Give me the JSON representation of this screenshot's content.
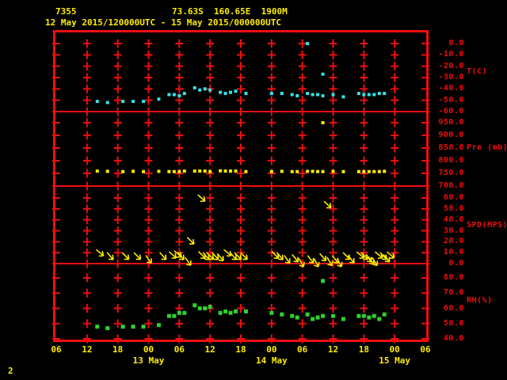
{
  "header": {
    "station_id": "7355",
    "location": "73.63S  160.65E  1900M",
    "period": "12 May 2015/120000UTC - 15 May 2015/000000UTC"
  },
  "footer": {
    "page_number": "2"
  },
  "colors": {
    "background": "#000000",
    "grid_red": "#ee0e0e",
    "text_yellow": "#ffec00",
    "temperature_cyan": "#35e2e2",
    "pressure_yellow": "#ffec00",
    "wind_yellow": "#ffec00",
    "humidity_green": "#2fd12f"
  },
  "chart_data": {
    "type": "scatter",
    "subtype": "multi-panel meteogram",
    "title": "12 May 2015/120000UTC - 15 May 2015/000000UTC",
    "x_axis": {
      "hours_span": 72,
      "tick_interval_hours": 6,
      "tick_labels": [
        "06",
        "12",
        "18",
        "00",
        "06",
        "12",
        "18",
        "00",
        "06",
        "12",
        "18",
        "00",
        "06"
      ],
      "date_labels": [
        {
          "text": "13 May",
          "tick_index": 3
        },
        {
          "text": "14 May",
          "tick_index": 7
        },
        {
          "text": "15 May",
          "tick_index": 11
        }
      ]
    },
    "panels": [
      {
        "id": "temperature",
        "label": "T(C)",
        "marker": "square",
        "color_key": "temperature_cyan",
        "y_ticks": [
          0,
          -10,
          -20,
          -30,
          -40,
          -50,
          -60
        ],
        "y_tick_labels": [
          "0.0",
          "-10.0",
          "-20.0",
          "-30.0",
          "-40.0",
          "-50.0",
          "-60.0"
        ],
        "points": [
          [
            8,
            -51
          ],
          [
            10,
            -52
          ],
          [
            13,
            -51
          ],
          [
            15,
            -51
          ],
          [
            17,
            -51
          ],
          [
            20,
            -49
          ],
          [
            22,
            -45
          ],
          [
            23,
            -45
          ],
          [
            24,
            -46
          ],
          [
            25,
            -44
          ],
          [
            27,
            -39
          ],
          [
            28,
            -41
          ],
          [
            29,
            -40
          ],
          [
            30,
            -41
          ],
          [
            32,
            -43
          ],
          [
            33,
            -44
          ],
          [
            34,
            -43
          ],
          [
            35,
            -42
          ],
          [
            37,
            -44
          ],
          [
            42,
            -44
          ],
          [
            44,
            -44
          ],
          [
            46,
            -45
          ],
          [
            47,
            -46
          ],
          [
            49,
            0
          ],
          [
            49,
            -44
          ],
          [
            50,
            -45
          ],
          [
            51,
            -45
          ],
          [
            52,
            -27
          ],
          [
            52,
            -46
          ],
          [
            54,
            -45
          ],
          [
            56,
            -47
          ],
          [
            59,
            -44
          ],
          [
            60,
            -45
          ],
          [
            61,
            -45
          ],
          [
            62,
            -45
          ],
          [
            63,
            -44
          ],
          [
            64,
            -44
          ]
        ]
      },
      {
        "id": "pressure",
        "label": "Pre (mb)",
        "marker": "square",
        "color_key": "pressure_yellow",
        "y_ticks": [
          950,
          900,
          850,
          800,
          750,
          700
        ],
        "y_tick_labels": [
          "950.0",
          "900.0",
          "850.0",
          "800.0",
          "750.0",
          "700.0"
        ],
        "points": [
          [
            8,
            759
          ],
          [
            10,
            758
          ],
          [
            13,
            757
          ],
          [
            15,
            758
          ],
          [
            17,
            757
          ],
          [
            20,
            758
          ],
          [
            22,
            757
          ],
          [
            23,
            757
          ],
          [
            24,
            757
          ],
          [
            25,
            759
          ],
          [
            27,
            759
          ],
          [
            28,
            759
          ],
          [
            29,
            759
          ],
          [
            30,
            757
          ],
          [
            32,
            760
          ],
          [
            33,
            759
          ],
          [
            34,
            759
          ],
          [
            35,
            759
          ],
          [
            37,
            757
          ],
          [
            42,
            757
          ],
          [
            44,
            758
          ],
          [
            46,
            757
          ],
          [
            47,
            757
          ],
          [
            49,
            758
          ],
          [
            50,
            758
          ],
          [
            51,
            757
          ],
          [
            52,
            950
          ],
          [
            52,
            757
          ],
          [
            54,
            758
          ],
          [
            56,
            757
          ],
          [
            59,
            757
          ],
          [
            60,
            757
          ],
          [
            61,
            757
          ],
          [
            62,
            757
          ],
          [
            63,
            757
          ],
          [
            64,
            758
          ]
        ]
      },
      {
        "id": "wind_speed",
        "label": "SPD(MPS)",
        "marker": "arrow",
        "color_key": "wind_yellow",
        "y_ticks": [
          60,
          50,
          40,
          30,
          20,
          10,
          0
        ],
        "y_tick_labels": [
          "60.0",
          "50.0",
          "40.0",
          "30.0",
          "20.0",
          "10.0",
          "0.0"
        ],
        "points_format": "[hour, speed_mps, arrow_direction_deg]",
        "points": [
          [
            8.5,
            10,
            40
          ],
          [
            10.5,
            7,
            50
          ],
          [
            13.5,
            7,
            45
          ],
          [
            15.8,
            7,
            45
          ],
          [
            18,
            4,
            55
          ],
          [
            20.8,
            7,
            48
          ],
          [
            22.7,
            8,
            42
          ],
          [
            23.7,
            9,
            40
          ],
          [
            24.3,
            7,
            50
          ],
          [
            25.7,
            2,
            55
          ],
          [
            26.2,
            21,
            45
          ],
          [
            28.3,
            60,
            42
          ],
          [
            28.4,
            8,
            45
          ],
          [
            29.2,
            7,
            48
          ],
          [
            30,
            7,
            45
          ],
          [
            31,
            7,
            48
          ],
          [
            32,
            6,
            50
          ],
          [
            33.4,
            10,
            40
          ],
          [
            34.5,
            7,
            48
          ],
          [
            35.4,
            7,
            45
          ],
          [
            36.6,
            7,
            45
          ],
          [
            42.7,
            8,
            45
          ],
          [
            43.6,
            7,
            50
          ],
          [
            45,
            4,
            55
          ],
          [
            46.6,
            5,
            50
          ],
          [
            47.8,
            1,
            60
          ],
          [
            49.6,
            4,
            52
          ],
          [
            50.7,
            1,
            62
          ],
          [
            52,
            6,
            48
          ],
          [
            52.9,
            54,
            42
          ],
          [
            53.3,
            2,
            60
          ],
          [
            54.4,
            4,
            52
          ],
          [
            55.2,
            1,
            62
          ],
          [
            56.6,
            7,
            45
          ],
          [
            57.5,
            4,
            50
          ],
          [
            59.3,
            8,
            40
          ],
          [
            60.1,
            7,
            45
          ],
          [
            60.9,
            5,
            50
          ],
          [
            61.4,
            3,
            55
          ],
          [
            62.1,
            2,
            58
          ],
          [
            62.9,
            8,
            40
          ],
          [
            63.8,
            7,
            45
          ],
          [
            64.4,
            5,
            50
          ],
          [
            65.2,
            8,
            42
          ]
        ]
      },
      {
        "id": "humidity",
        "label": "RH(%)",
        "marker": "square",
        "color_key": "humidity_green",
        "y_ticks": [
          80,
          70,
          60,
          50,
          40
        ],
        "y_tick_labels": [
          "80.0",
          "70.0",
          "60.0",
          "50.0",
          "40.0"
        ],
        "points": [
          [
            8,
            48
          ],
          [
            10,
            47
          ],
          [
            13,
            48
          ],
          [
            15,
            48
          ],
          [
            17,
            48
          ],
          [
            20,
            49
          ],
          [
            22,
            55
          ],
          [
            23,
            55
          ],
          [
            24,
            57
          ],
          [
            25,
            57
          ],
          [
            27,
            62
          ],
          [
            28,
            60
          ],
          [
            29,
            60
          ],
          [
            30,
            61
          ],
          [
            32,
            57
          ],
          [
            33,
            58
          ],
          [
            34,
            57
          ],
          [
            35,
            58
          ],
          [
            37,
            58
          ],
          [
            42,
            57
          ],
          [
            44,
            56
          ],
          [
            46,
            55
          ],
          [
            47,
            54
          ],
          [
            49,
            56
          ],
          [
            50,
            53
          ],
          [
            51,
            54
          ],
          [
            52,
            78
          ],
          [
            52,
            55
          ],
          [
            54,
            55
          ],
          [
            56,
            53
          ],
          [
            59,
            55
          ],
          [
            60,
            55
          ],
          [
            61,
            54
          ],
          [
            62,
            55
          ],
          [
            63,
            53
          ],
          [
            64,
            56
          ]
        ]
      }
    ]
  }
}
